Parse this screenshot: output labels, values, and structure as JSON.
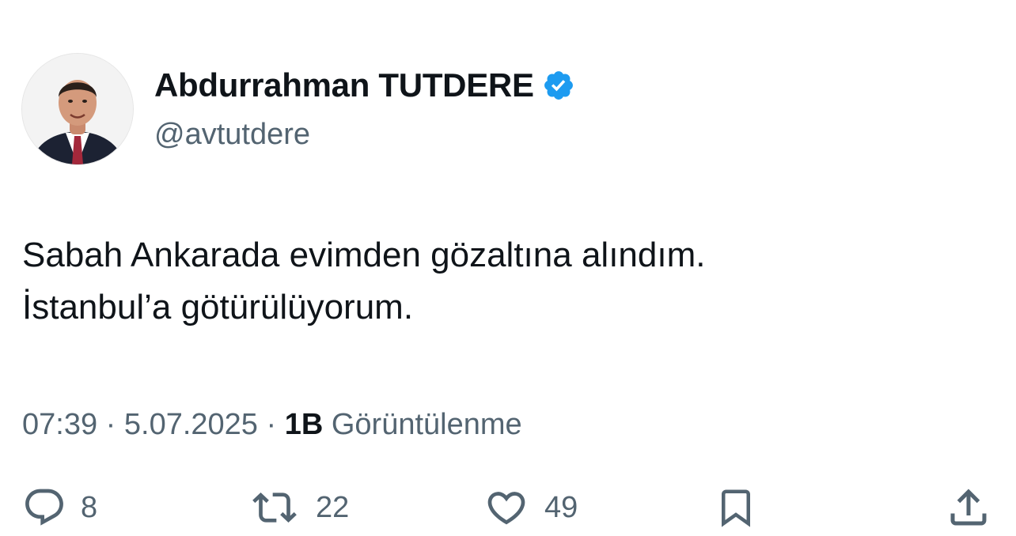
{
  "author": {
    "display_name": "Abdurrahman TUTDERE",
    "handle": "@avtutdere",
    "verified": true,
    "verified_color": "#1d9bf0"
  },
  "tweet": {
    "lines": [
      "Sabah Ankarada evimden gözaltına alındım.",
      "İstanbul’a götürülüyorum."
    ]
  },
  "meta": {
    "time": "07:39",
    "separator": " · ",
    "date": "5.07.2025",
    "views_count": "1B",
    "views_label": " Görüntülenme"
  },
  "actions": {
    "reply_count": "8",
    "retweet_count": "22",
    "like_count": "49",
    "icons": [
      "reply-icon",
      "retweet-icon",
      "like-icon",
      "bookmark-icon",
      "share-icon"
    ]
  },
  "colors": {
    "text": "#0f1419",
    "secondary": "#536471"
  }
}
